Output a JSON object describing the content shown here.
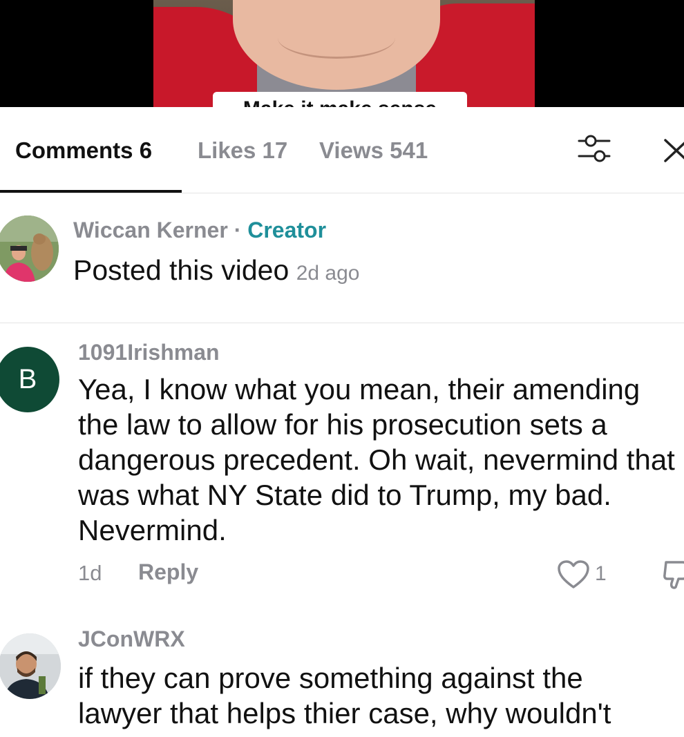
{
  "video": {
    "caption": "Make it make sense"
  },
  "tabs": {
    "comments": "Comments 6",
    "likes": "Likes 17",
    "views": "Views 541"
  },
  "creator_post": {
    "name": "Wiccan Kerner",
    "separator": "·",
    "badge": "Creator",
    "text": "Posted this video",
    "time": "2d ago"
  },
  "comments": [
    {
      "avatar_letter": "B",
      "username": "1091Irishman",
      "text": "Yea, I know what you mean, their amending the law to allow for his prosecution sets a dangerous precedent. Oh wait, nevermind that was what NY State did to Trump, my bad. Nevermind.",
      "time": "1d",
      "reply_label": "Reply",
      "like_count": "1"
    },
    {
      "username": "JConWRX",
      "text_lines": [
        "if they can prove something against the",
        "lawyer that helps thier case, why wouldn't"
      ]
    }
  ],
  "icons": {
    "filter": "sliders-icon",
    "close": "close-icon",
    "like": "heart-outline-icon",
    "dislike": "thumb-down-icon"
  },
  "colors": {
    "creator_badge": "#1f8f9a",
    "avatar_b_bg": "#0f4a35",
    "muted_text": "#8a8b91"
  }
}
